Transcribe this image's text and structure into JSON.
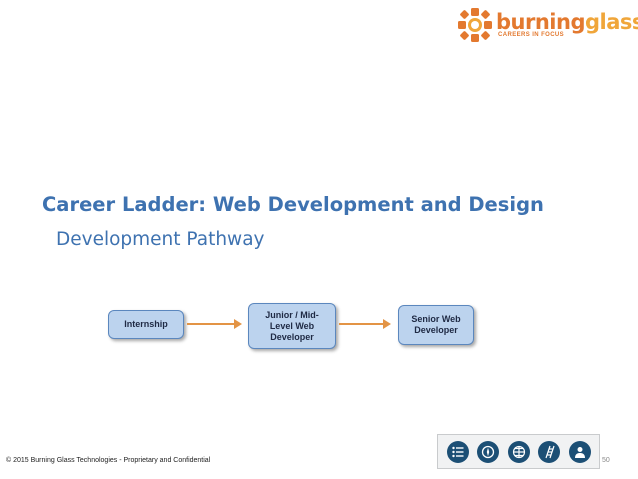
{
  "logo": {
    "word_part1": "burning",
    "word_part2": "glass",
    "tagline": "CAREERS IN FOCUS",
    "colors": {
      "primary": "#e3792f",
      "secondary": "#f0a63a"
    }
  },
  "title": "Career Ladder: Web Development and Design",
  "subtitle": "Development Pathway",
  "pathway": {
    "steps": [
      {
        "lines": [
          "Internship"
        ]
      },
      {
        "lines": [
          "Junior / Mid-",
          "Level Web",
          "Developer"
        ]
      },
      {
        "lines": [
          "Senior Web",
          "Developer"
        ]
      }
    ]
  },
  "footer": {
    "copyright": "© 2015 Burning Glass Technologies - Proprietary and Confidential",
    "page_number": "50"
  },
  "icon_bar": {
    "icons": [
      "list-icon",
      "compass-icon",
      "grid-icon",
      "ladder-icon",
      "people-icon"
    ]
  },
  "colors": {
    "title": "#3e72b0",
    "box_fill": "#bcd3ee",
    "box_border": "#5b87be",
    "arrow": "#e39445",
    "icon": "#1c4f75"
  }
}
